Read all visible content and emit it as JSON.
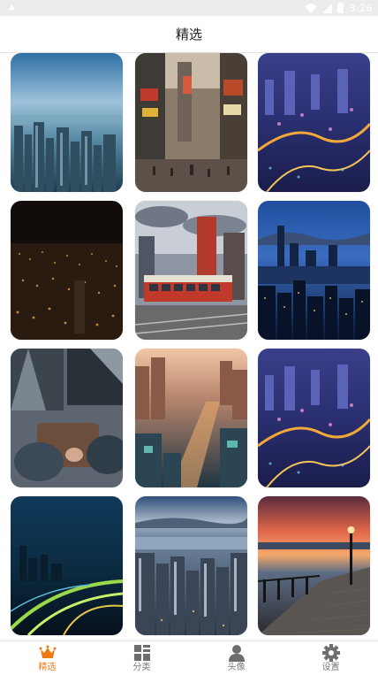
{
  "status_bar": {
    "time": "3:26",
    "icons": [
      "signal-icon",
      "wifi-icon",
      "lock-icon",
      "battery-icon"
    ]
  },
  "header": {
    "title": "精选"
  },
  "gallery": {
    "items": [
      {
        "theme": "skyline-blue"
      },
      {
        "theme": "times-square"
      },
      {
        "theme": "night-city-purple"
      },
      {
        "theme": "dark-city-lights"
      },
      {
        "theme": "streetcar-hdr"
      },
      {
        "theme": "harbor-night"
      },
      {
        "theme": "rooftop-hands"
      },
      {
        "theme": "aerial-sunset"
      },
      {
        "theme": "night-city-purple"
      },
      {
        "theme": "highway-night"
      },
      {
        "theme": "harbor-day"
      },
      {
        "theme": "pier-sunset"
      }
    ]
  },
  "bottom_nav": {
    "active_color": "#f07a12",
    "inactive_color": "#7a7a7a",
    "items": [
      {
        "label": "精选",
        "icon": "crown-icon",
        "active": true
      },
      {
        "label": "分类",
        "icon": "grid-icon",
        "active": false
      },
      {
        "label": "头像",
        "icon": "person-icon",
        "active": false
      },
      {
        "label": "设置",
        "icon": "gear-icon",
        "active": false
      }
    ]
  }
}
